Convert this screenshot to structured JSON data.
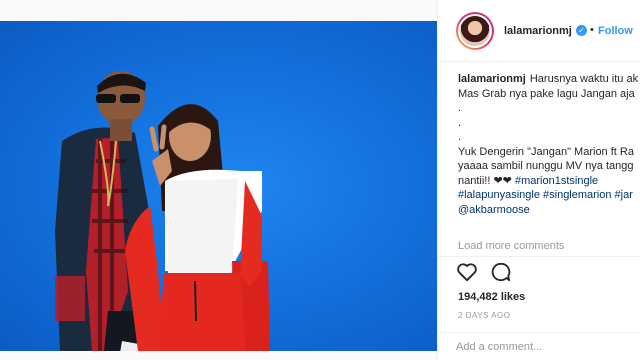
{
  "post": {
    "photo_description_icon": "photo"
  },
  "header": {
    "username": "lalamarionmj",
    "verified_glyph": "✓",
    "separator": "•",
    "follow_label": "Follow"
  },
  "caption": {
    "username": "lalamarionmj",
    "line1": "Harusnya waktu itu ak",
    "line2": "Mas Grab nya pake lagu Jangan aja",
    "line3": ".",
    "line4": ".",
    "line5": ".",
    "line6": "Yuk Dengerin \"Jangan\" Marion ft Ra",
    "line7": "yaaaa sambil nunggu MV nya tangg",
    "line8_text": "nantii!! ❤❤",
    "line8_tag": "#marion1stsingle",
    "line9": "#lalapunyasingle #singlemarion #jar",
    "line10": "@akbarmoose"
  },
  "comments": {
    "load_more_label": "Load more comments"
  },
  "actions": {
    "like_icon": "heart-icon",
    "comment_icon": "comment-icon"
  },
  "likes": {
    "count_text": "194,482 likes"
  },
  "time": {
    "label": "2 DAYS AGO"
  },
  "add_comment": {
    "placeholder": "Add a comment..."
  },
  "colors": {
    "accent": "#3897f0",
    "photo_blue": "#1472de",
    "hashtag": "#003569",
    "muted": "#999999"
  }
}
